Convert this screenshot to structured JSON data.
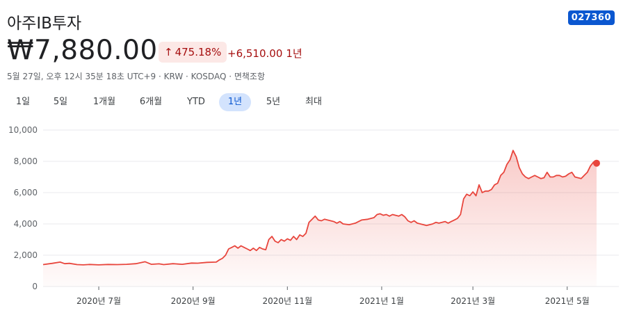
{
  "header": {
    "stock_name": "아주IB투자",
    "ticker": "027360",
    "price": "₩7,880.00",
    "change_pct": "475.18%",
    "change_abs": "+6,510.00",
    "change_period": "1년",
    "meta": "5월 27일, 오후 12시 35분 18초 UTC+9 · KRW · KOSDAQ · 면책조항"
  },
  "icons": {
    "change_arrow": "arrow-up-icon"
  },
  "colors": {
    "line": "#e8453c",
    "accent": "#0b57d0",
    "negative_text": "#a50e0e",
    "pill_bg": "#fce8e6"
  },
  "tabs": [
    {
      "label": "1일"
    },
    {
      "label": "5일"
    },
    {
      "label": "1개월"
    },
    {
      "label": "6개월"
    },
    {
      "label": "YTD"
    },
    {
      "label": "1년"
    },
    {
      "label": "5년"
    },
    {
      "label": "최대"
    }
  ],
  "active_tab": 5,
  "chart_data": {
    "type": "area",
    "title": "",
    "xlabel": "",
    "ylabel": "",
    "ylim": [
      0,
      10000
    ],
    "yticks": [
      0,
      2000,
      4000,
      6000,
      8000,
      10000
    ],
    "ytick_labels": [
      "0",
      "2,000",
      "4,000",
      "6,000",
      "8,000",
      "10,000"
    ],
    "xlim": [
      0,
      358
    ],
    "xticks": [
      {
        "x": 36,
        "label": "2020년 7월"
      },
      {
        "x": 97,
        "label": "2020년 9월"
      },
      {
        "x": 158,
        "label": "2020년 11월"
      },
      {
        "x": 219,
        "label": "2021년 1월"
      },
      {
        "x": 278,
        "label": "2021년 3월"
      },
      {
        "x": 339,
        "label": "2021년 5월"
      }
    ],
    "grid": true,
    "series": [
      {
        "x": [
          0,
          6,
          11,
          14,
          17,
          22,
          26,
          30,
          36,
          42,
          48,
          54,
          60,
          66,
          70,
          75,
          78,
          84,
          90,
          96,
          100,
          106,
          112,
          114,
          116,
          118,
          120,
          122,
          124,
          126,
          128,
          130,
          132,
          134,
          136,
          138,
          140,
          142,
          144,
          146,
          148,
          150,
          152,
          154,
          156,
          158,
          160,
          162,
          164,
          166,
          168,
          170,
          172,
          174,
          176,
          178,
          180,
          182,
          184,
          186,
          188,
          190,
          192,
          194,
          198,
          202,
          206,
          210,
          214,
          216,
          218,
          220,
          222,
          224,
          226,
          228,
          230,
          232,
          234,
          236,
          238,
          240,
          242,
          244,
          246,
          248,
          250,
          252,
          254,
          256,
          258,
          260,
          262,
          264,
          266,
          268,
          270,
          272,
          274,
          276,
          278,
          280,
          282,
          284,
          286,
          288,
          290,
          292,
          294,
          296,
          298,
          300,
          302,
          304,
          306,
          308,
          310,
          312,
          314,
          316,
          318,
          320,
          322,
          324,
          326,
          328,
          330,
          332,
          334,
          336,
          338,
          340,
          342,
          344,
          346,
          348,
          350,
          352,
          354,
          356,
          358
        ],
        "values": [
          1400,
          1480,
          1560,
          1460,
          1480,
          1400,
          1380,
          1410,
          1380,
          1410,
          1400,
          1420,
          1460,
          1580,
          1420,
          1450,
          1400,
          1460,
          1420,
          1500,
          1490,
          1540,
          1560,
          1700,
          1800,
          2000,
          2400,
          2500,
          2600,
          2450,
          2600,
          2500,
          2400,
          2300,
          2450,
          2300,
          2500,
          2400,
          2350,
          3000,
          3200,
          2900,
          2800,
          3000,
          2900,
          3050,
          2950,
          3200,
          3000,
          3300,
          3200,
          3400,
          4100,
          4300,
          4500,
          4250,
          4200,
          4300,
          4250,
          4200,
          4150,
          4050,
          4150,
          4000,
          3950,
          4050,
          4250,
          4300,
          4400,
          4600,
          4650,
          4550,
          4600,
          4500,
          4600,
          4550,
          4500,
          4600,
          4450,
          4200,
          4100,
          4200,
          4050,
          4000,
          3950,
          3900,
          3950,
          4000,
          4100,
          4050,
          4100,
          4150,
          4050,
          4150,
          4250,
          4350,
          4600,
          5600,
          5900,
          5800,
          6050,
          5800,
          6500,
          6000,
          6100,
          6100,
          6200,
          6500,
          6600,
          7100,
          7300,
          7800,
          8100,
          8700,
          8300,
          7600,
          7200,
          7000,
          6900,
          7000,
          7100,
          7000,
          6900,
          6950,
          7300,
          7000,
          7000,
          7100,
          7100,
          7000,
          7050,
          7200,
          7300,
          7000,
          6950,
          6900,
          7100,
          7300,
          7700,
          7950,
          7880
        ]
      }
    ]
  }
}
